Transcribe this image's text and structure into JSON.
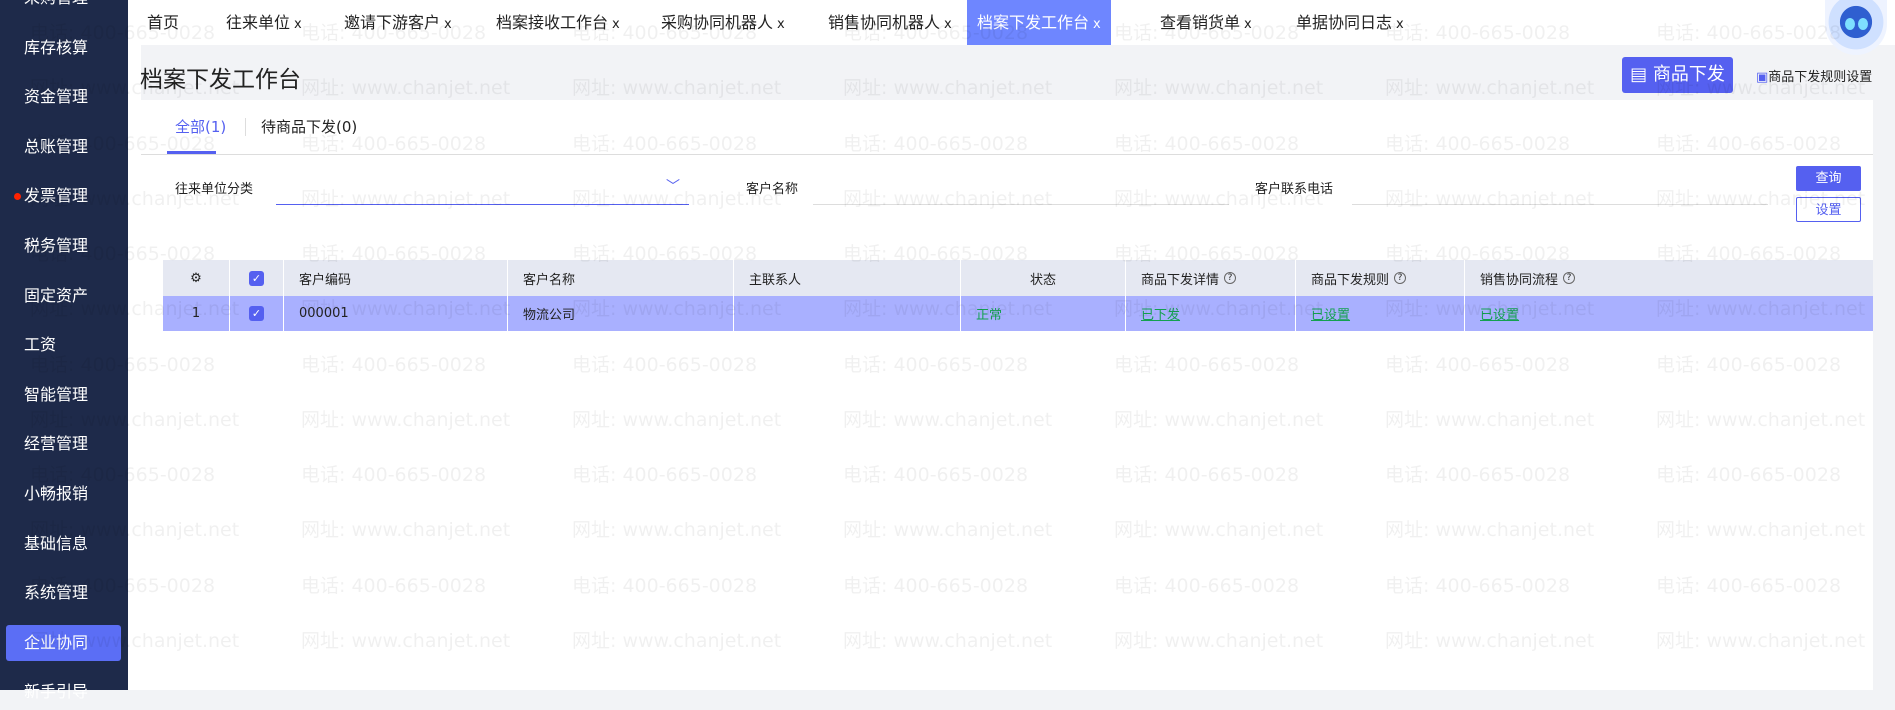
{
  "sidebar": {
    "items": [
      {
        "label": "采购管理"
      },
      {
        "label": "库存核算"
      },
      {
        "label": "资金管理"
      },
      {
        "label": "总账管理"
      },
      {
        "label": "发票管理",
        "dot": true
      },
      {
        "label": "税务管理"
      },
      {
        "label": "固定资产"
      },
      {
        "label": "工资"
      },
      {
        "label": "智能管理"
      },
      {
        "label": "经营管理"
      },
      {
        "label": "小畅报销"
      },
      {
        "label": "基础信息"
      },
      {
        "label": "系统管理"
      },
      {
        "label": "企业协同",
        "active": true
      },
      {
        "label": "新手引导"
      }
    ]
  },
  "tabs": [
    {
      "label": "首页",
      "closable": false
    },
    {
      "label": "往来单位",
      "closable": true
    },
    {
      "label": "邀请下游客户",
      "closable": true
    },
    {
      "label": "档案接收工作台",
      "closable": true
    },
    {
      "label": "采购协同机器人",
      "closable": true
    },
    {
      "label": "销售协同机器人",
      "closable": true
    },
    {
      "label": "档案下发工作台",
      "closable": true,
      "active": true
    },
    {
      "label": "查看销货单",
      "closable": true
    },
    {
      "label": "单据协同日志",
      "closable": true
    }
  ],
  "close_glyph": "x",
  "page": {
    "title": "档案下发工作台",
    "issue_button": "商品下发",
    "rule_link": "商品下发规则设置"
  },
  "subtabs": [
    {
      "label": "全部(1)"
    },
    {
      "label": "待商品下发(0)"
    }
  ],
  "filters": {
    "category_label": "往来单位分类",
    "name_label": "客户名称",
    "phone_label": "客户联系电话",
    "query": "查询",
    "settings": "设置"
  },
  "table": {
    "headers": [
      "客户编码",
      "客户名称",
      "主联系人",
      "状态",
      "商品下发详情",
      "商品下发规则",
      "销售协同流程"
    ],
    "rows": [
      {
        "index": "1",
        "code": "000001",
        "name": "物流公司",
        "contact": "",
        "status": "正常",
        "detail": "已下发",
        "rule": "已设置",
        "flow": "已设置"
      }
    ]
  },
  "watermark": {
    "phone": "电话: 400-665-0028",
    "site": "网址: www.chanjet.net"
  },
  "colors": {
    "primary": "#5560f0",
    "active_tab": "#6e86ff",
    "sidebar": "#1e2a4a",
    "row_selected": "#a9b0ff",
    "link": "#14a050"
  }
}
